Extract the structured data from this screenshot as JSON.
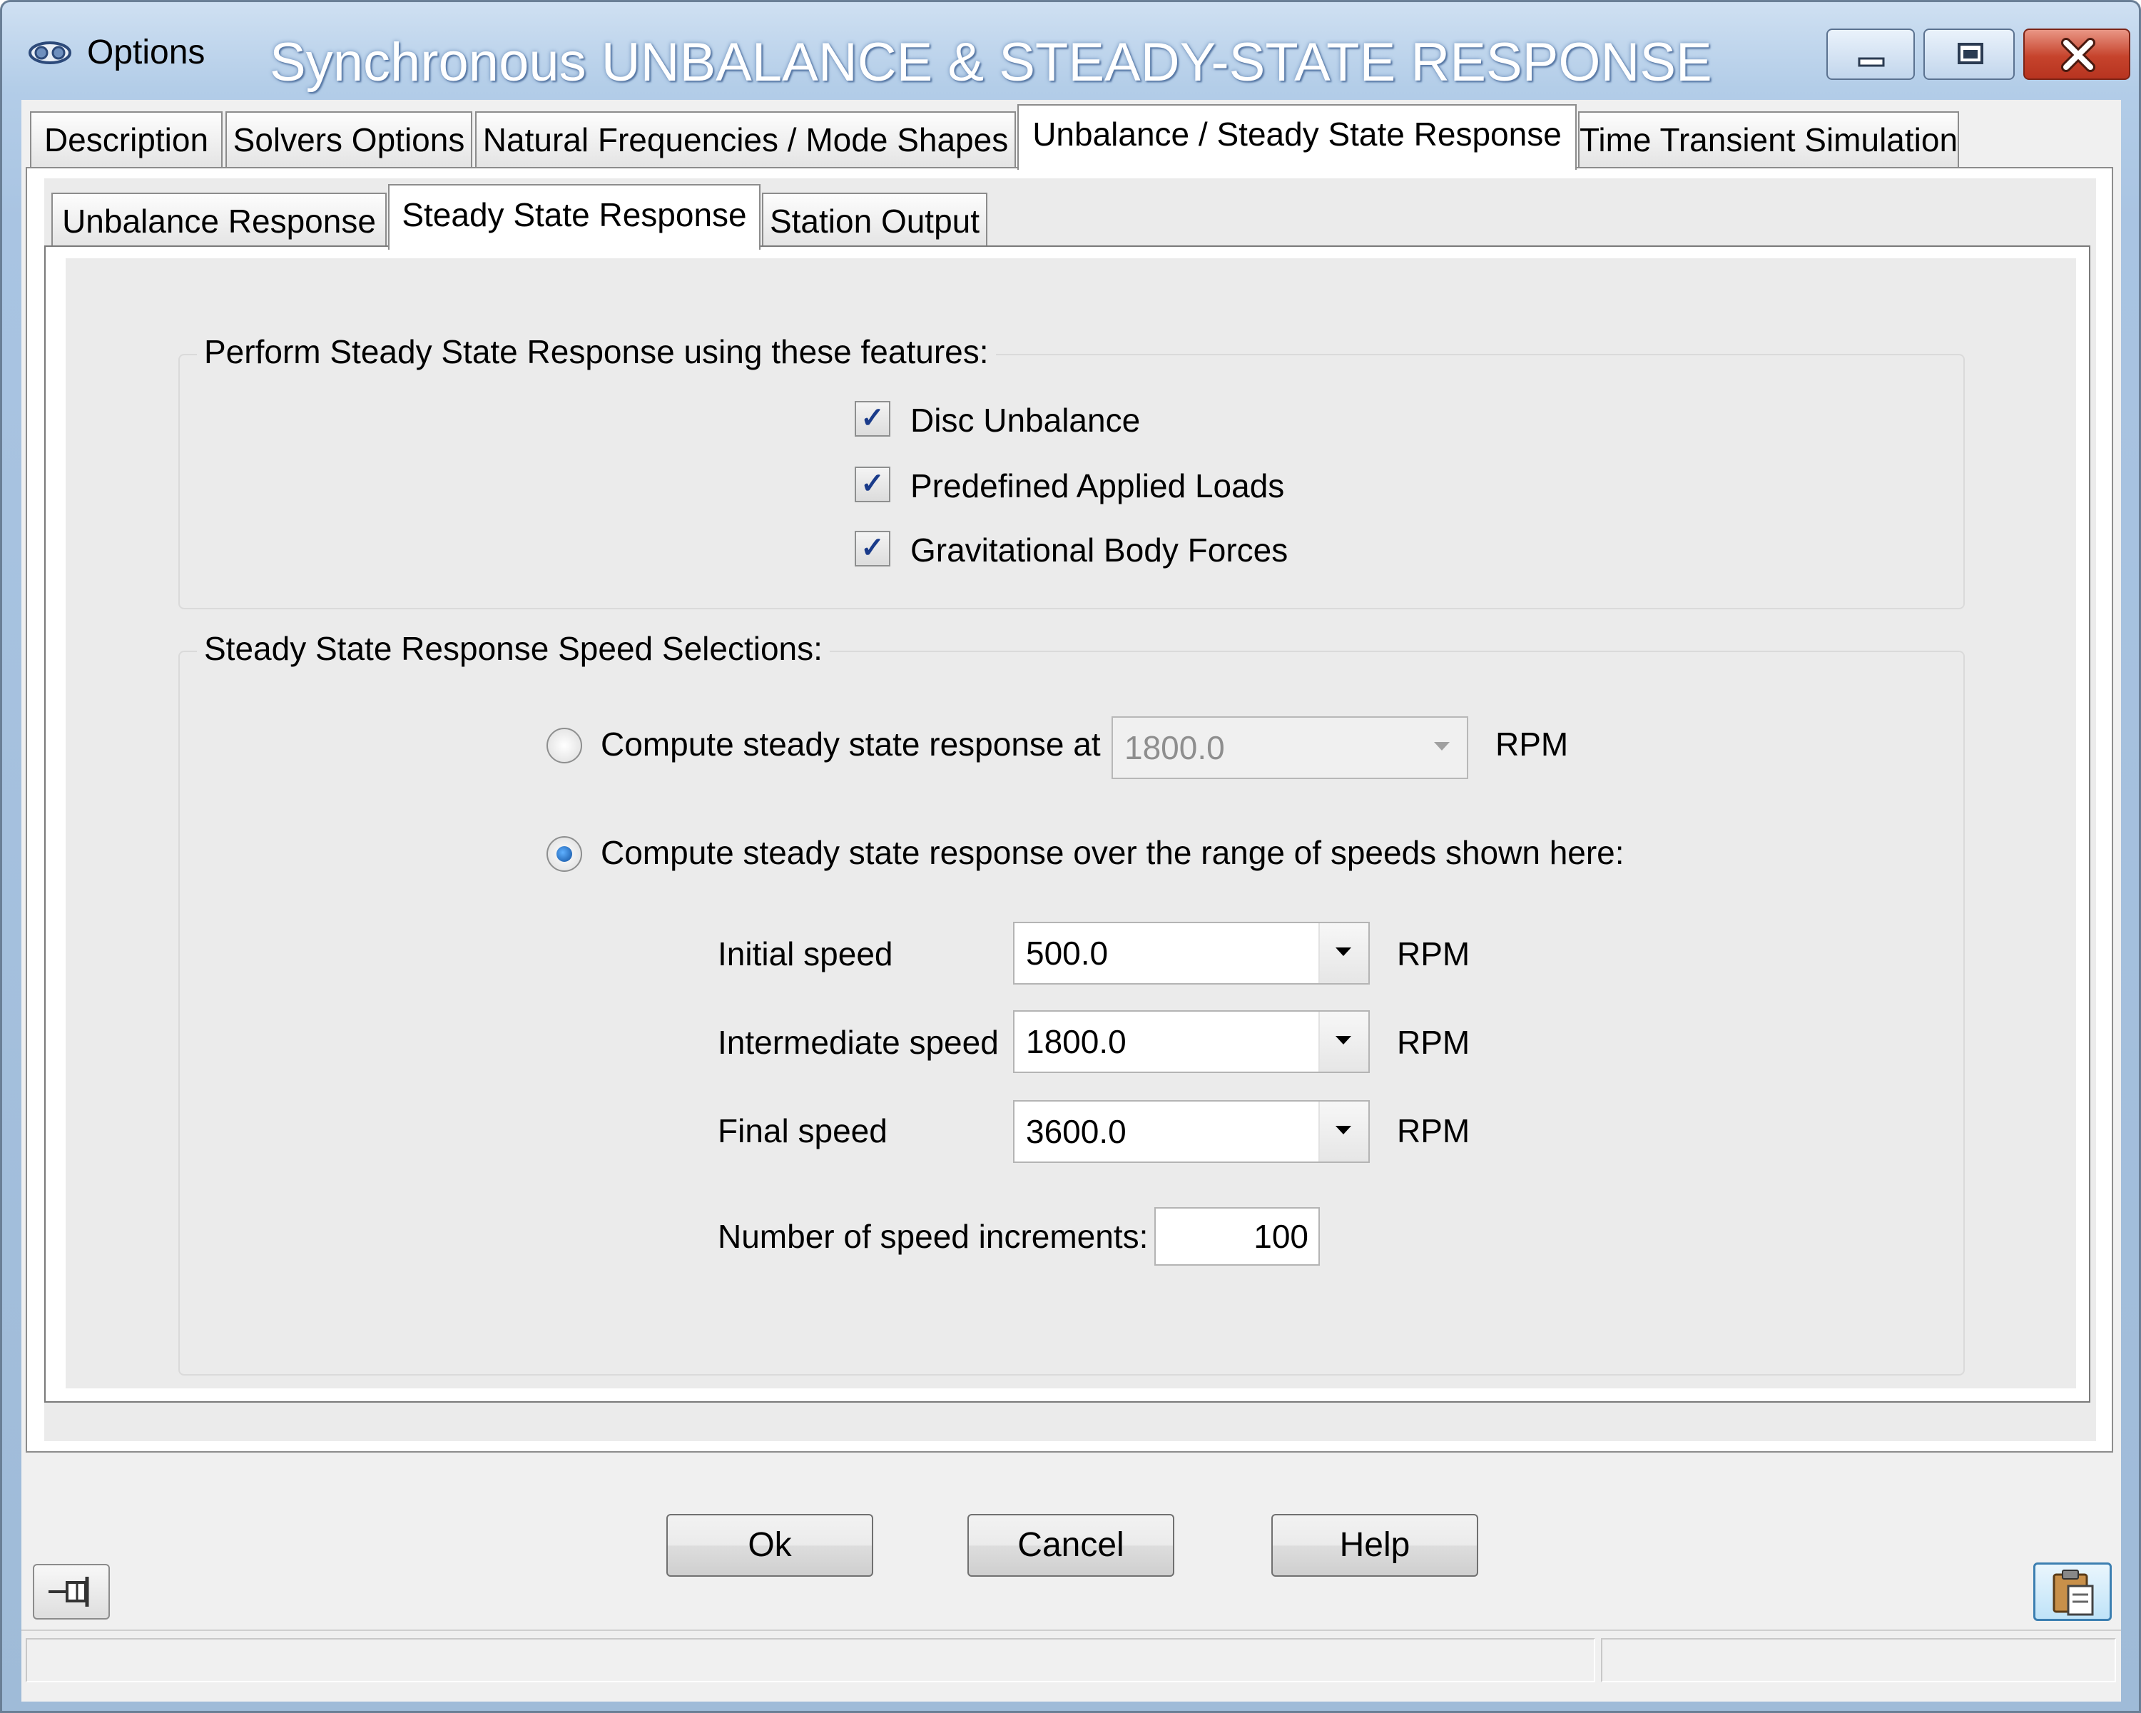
{
  "window": {
    "title": "Options",
    "overlay_title": "Synchronous UNBALANCE  & STEADY-STATE RESPONSE"
  },
  "tabs": [
    {
      "label": "Description"
    },
    {
      "label": "Solvers Options"
    },
    {
      "label": "Natural Frequencies / Mode Shapes"
    },
    {
      "label": "Unbalance / Steady State Response",
      "active": true
    },
    {
      "label": "Time Transient Simulation"
    }
  ],
  "subtabs": [
    {
      "label": "Unbalance Response"
    },
    {
      "label": "Steady State Response",
      "active": true
    },
    {
      "label": "Station Output"
    }
  ],
  "features": {
    "legend": "Perform Steady State Response using these features:",
    "items": [
      {
        "label": "Disc Unbalance",
        "checked": true
      },
      {
        "label": "Predefined Applied Loads",
        "checked": true
      },
      {
        "label": "Gravitational Body Forces",
        "checked": true
      }
    ]
  },
  "speeds": {
    "legend": "Steady State Response Speed Selections:",
    "single": {
      "label": "Compute steady state response at",
      "value": "1800.0",
      "unit": "RPM",
      "selected": false
    },
    "range": {
      "label": "Compute steady state response over the range of speeds shown here:",
      "selected": true,
      "initial": {
        "label": "Initial speed",
        "value": "500.0",
        "unit": "RPM"
      },
      "intermediate": {
        "label": "Intermediate speed",
        "value": "1800.0",
        "unit": "RPM"
      },
      "final": {
        "label": "Final speed",
        "value": "3600.0",
        "unit": "RPM"
      },
      "increments": {
        "label": "Number of speed increments:",
        "value": "100"
      }
    }
  },
  "buttons": {
    "ok": "Ok",
    "cancel": "Cancel",
    "help": "Help"
  },
  "icons": {
    "app": "options-app-icon",
    "pin": "pin-icon",
    "clipboard": "clipboard-icon",
    "checkmark": "✓"
  }
}
